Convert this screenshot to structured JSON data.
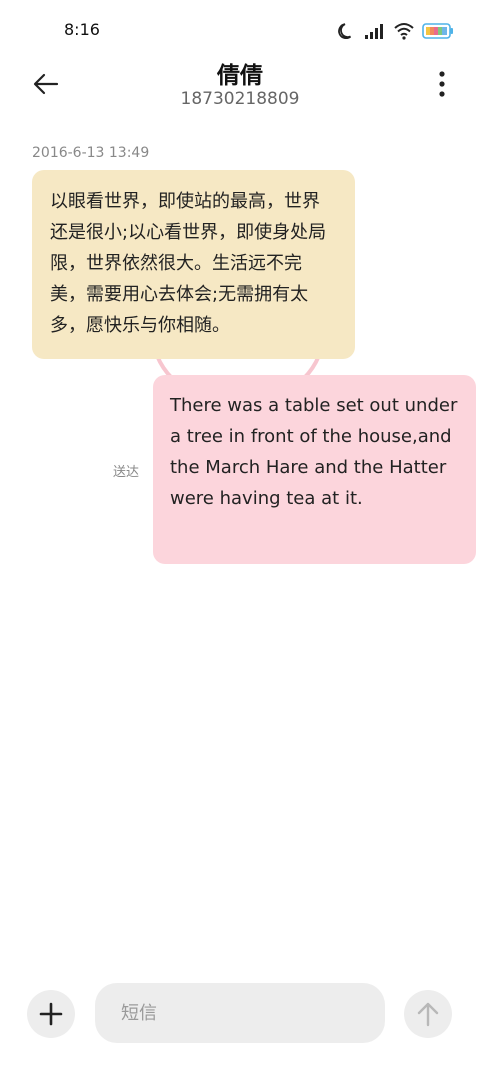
{
  "status_bar": {
    "time": "8:16",
    "icons": [
      "moon-icon",
      "signal-icon",
      "wifi-icon",
      "battery-icon"
    ]
  },
  "header": {
    "contact_name": "倩倩",
    "contact_number": "18730218809",
    "back_icon": "arrow-left-icon",
    "more_icon": "more-vertical-icon"
  },
  "conversation": {
    "timestamp": "2016-6-13 13:49",
    "messages": [
      {
        "direction": "incoming",
        "text": "以眼看世界，即使站的最高，世界还是很小;以心看世界，即使身处局限，世界依然很大。生活远不完美，需要用心去体会;无需拥有太多，愿快乐与你相随。"
      },
      {
        "direction": "outgoing",
        "text": "There was a table set out under a tree in front of the house,and the March Hare and the Hatter were having tea at it.",
        "status": "送达"
      }
    ]
  },
  "composer": {
    "placeholder": "短信",
    "value": "",
    "attach_icon": "plus-icon",
    "send_icon": "arrow-up-icon"
  },
  "colors": {
    "incoming_bubble": "#f6e8c4",
    "outgoing_bubble": "#fcd5dc",
    "button_bg": "#ededed",
    "battery_accent": "#4fb3e8"
  }
}
